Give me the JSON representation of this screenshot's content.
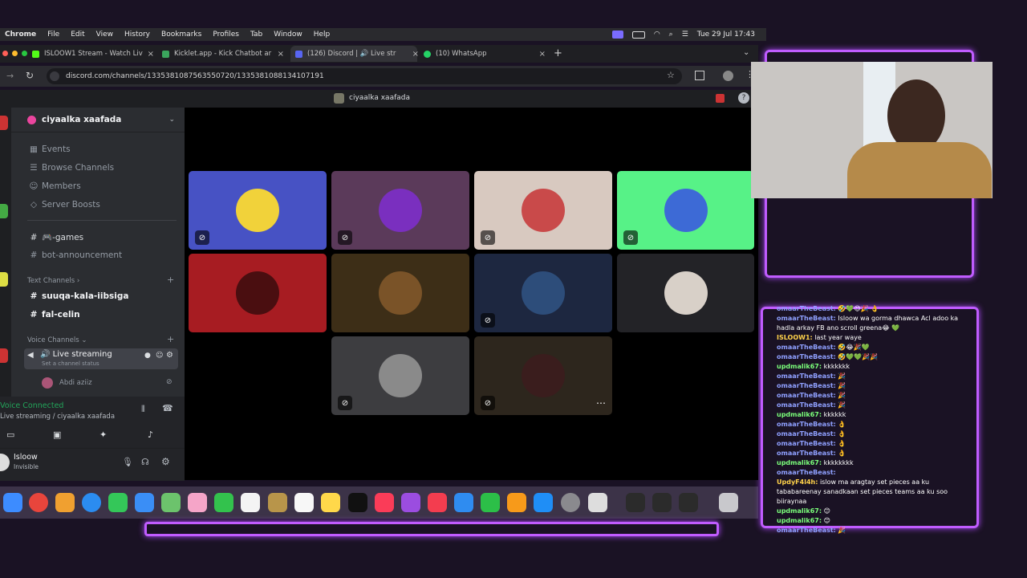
{
  "menubar": {
    "brand": "Chrome",
    "items": [
      "File",
      "Edit",
      "View",
      "History",
      "Bookmarks",
      "Profiles",
      "Tab",
      "Window",
      "Help"
    ],
    "datetime": "Tue 29 Jul  17:43"
  },
  "tabs": [
    {
      "title": "ISLOOW1 Stream - Watch Liv",
      "color": "#53fc18"
    },
    {
      "title": "Kicklet.app - Kick Chatbot ar",
      "color": "#3ba55d"
    },
    {
      "title": "(126) Discord | 🔊 Live str",
      "color": "#5865f2"
    },
    {
      "title": "(10) WhatsApp",
      "color": "#25d366"
    }
  ],
  "address": {
    "url": "discord.com/channels/1335381087563550720/1335381088134107191"
  },
  "discord": {
    "header_title": "ciyaalka xaafada",
    "server_name": "ciyaalka xaafada",
    "menu": [
      "Events",
      "Browse Channels",
      "Members",
      "Server Boosts"
    ],
    "channels_top": [
      "🎮-games",
      "bot-announcement"
    ],
    "text_category": "Text Channels",
    "text_channels": [
      "suuqa-kala-iibsiga",
      "fal-celin"
    ],
    "voice_category": "Voice Channels",
    "voice_channel": "🔊 Live streaming",
    "voice_status": "Set a channel status",
    "voice_member": "Abdi aziiz",
    "voice_connected": "Voice Connected",
    "voice_location": "Live streaming / ciyaalka xaafada",
    "user_name": "Isloow",
    "user_status": "Invisible"
  },
  "tiles": [
    {
      "bg": "#4752c4",
      "av": "#f1d23a"
    },
    {
      "bg": "#5b3a5a",
      "av": "#7a2fbf"
    },
    {
      "bg": "#d8c9c0",
      "av": "#c94a4a"
    },
    {
      "bg": "#57f287",
      "av": "#3d6ad6"
    },
    {
      "bg": "#a71c22",
      "av": "#4a0e10"
    },
    {
      "bg": "#3d2e17",
      "av": "#7a5328"
    },
    {
      "bg": "#1d2740",
      "av": "#2d4d7a"
    },
    {
      "bg": "#232327",
      "av": "#d8d0c8"
    },
    {
      "bg": "#3d3d40",
      "av": "#8a8a8a"
    },
    {
      "bg": "#2d261d",
      "av": "#3a1d1d"
    }
  ],
  "chat": [
    {
      "user": "omaarTheBeast:",
      "text": "🤣💚😍🎉 👌",
      "c": "u1"
    },
    {
      "user": "omaarTheBeast:",
      "text": "Isloow wa gorma dhawca Acl adoo ka",
      "c": "u1"
    },
    {
      "user": "",
      "text": "hadla arkay FB ano scroll greena😂 💚",
      "c": ""
    },
    {
      "user": "ISLOOW1:",
      "text": "last year waye",
      "c": "u3"
    },
    {
      "user": "omaarTheBeast:",
      "text": "🤣😂🎉💚",
      "c": "u1"
    },
    {
      "user": "omaarTheBeast:",
      "text": "🤣💚💚🎉🎉",
      "c": "u1"
    },
    {
      "user": "updmalik67:",
      "text": "kkkkkkk",
      "c": "u2"
    },
    {
      "user": "omaarTheBeast:",
      "text": "🎉",
      "c": "u1"
    },
    {
      "user": "omaarTheBeast:",
      "text": "🎉",
      "c": "u1"
    },
    {
      "user": "omaarTheBeast:",
      "text": "🎉",
      "c": "u1"
    },
    {
      "user": "omaarTheBeast:",
      "text": "🎉",
      "c": "u1"
    },
    {
      "user": "updmalik67:",
      "text": "kkkkkk",
      "c": "u2"
    },
    {
      "user": "omaarTheBeast:",
      "text": "👌",
      "c": "u1"
    },
    {
      "user": "omaarTheBeast:",
      "text": "👌",
      "c": "u1"
    },
    {
      "user": "omaarTheBeast:",
      "text": "👌",
      "c": "u1"
    },
    {
      "user": "omaarTheBeast:",
      "text": "👌",
      "c": "u1"
    },
    {
      "user": "updmalik67:",
      "text": "kkkkkkkk",
      "c": "u2"
    },
    {
      "user": "omaarTheBeast:",
      "text": "",
      "c": "u1"
    },
    {
      "user": "UpdyF4l4h:",
      "text": "islow ma aragtay set pieces aa ku",
      "c": "u3"
    },
    {
      "user": "",
      "text": "tababareenay sanadkaan set pieces teams aa ku soo",
      "c": ""
    },
    {
      "user": "",
      "text": "biiraynaa",
      "c": ""
    },
    {
      "user": "updmalik67:",
      "text": "😊",
      "c": "u2"
    },
    {
      "user": "updmalik67:",
      "text": "😊",
      "c": "u2"
    },
    {
      "user": "omaarTheBeast:",
      "text": "🎉",
      "c": "u1"
    }
  ]
}
